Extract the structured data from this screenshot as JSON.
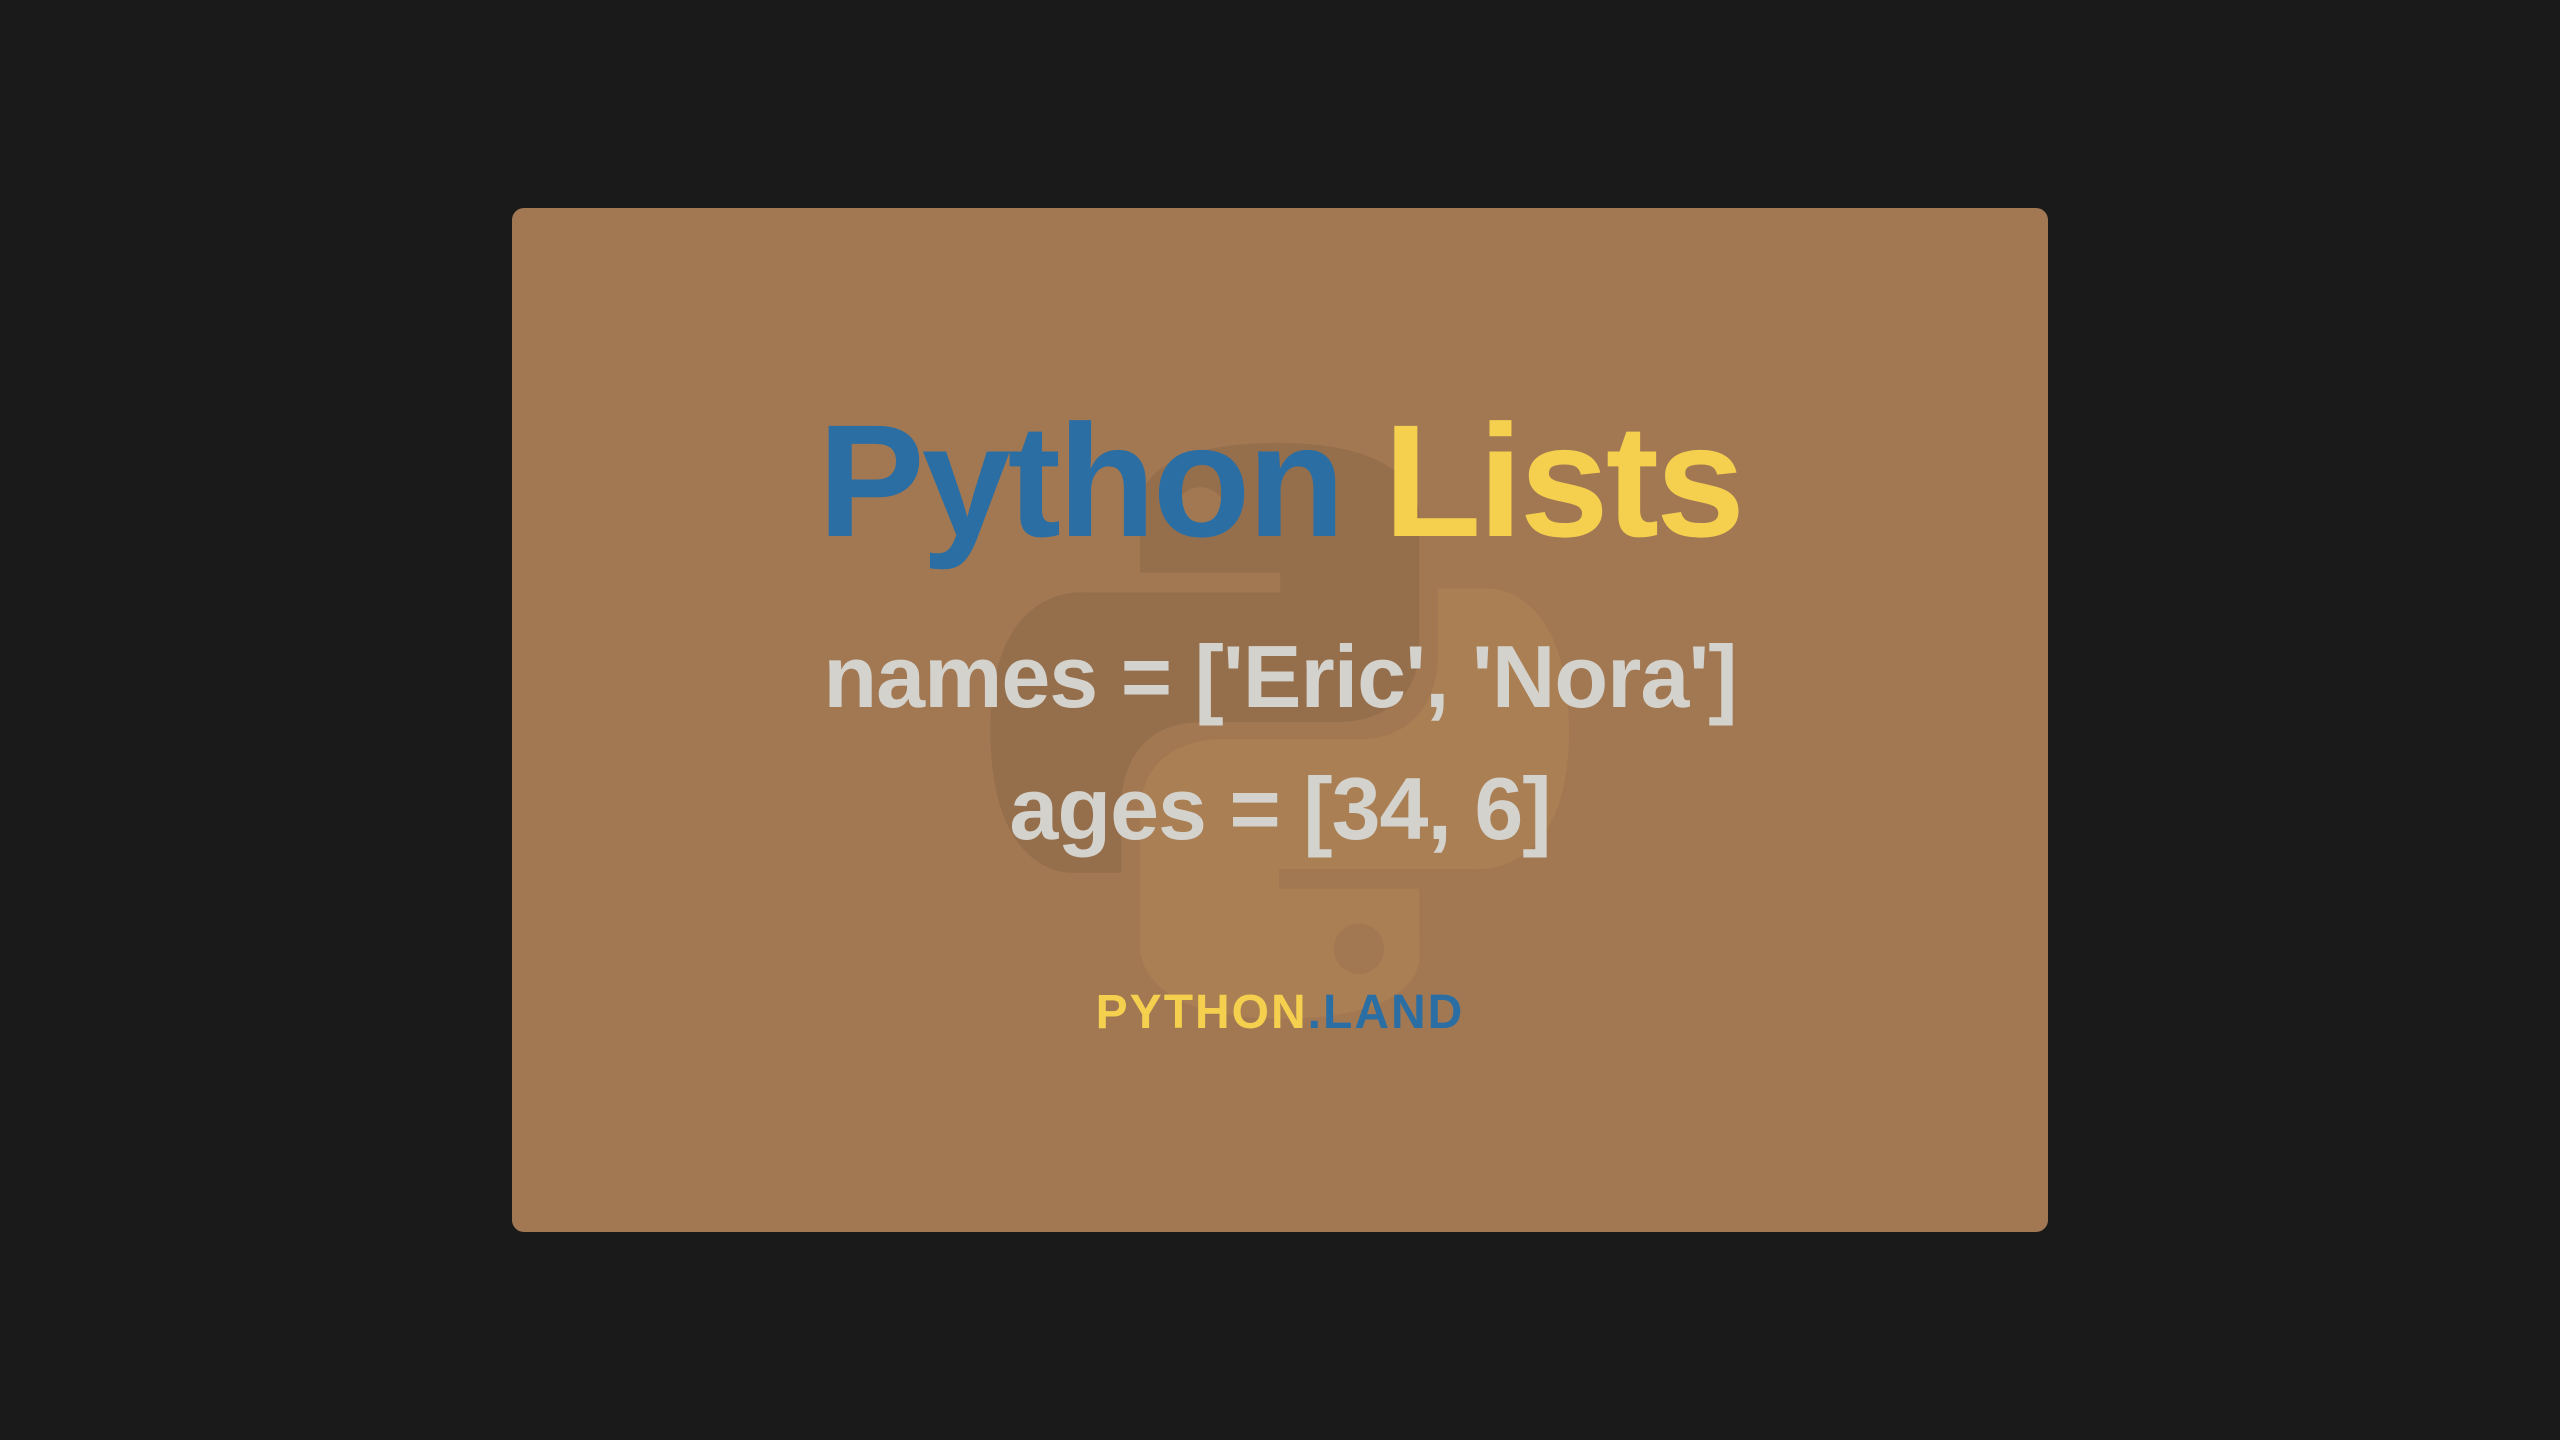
{
  "title": {
    "word1": "Python",
    "word2": "Lists"
  },
  "code": {
    "line1": "names = ['Eric', 'Nora']",
    "line2": "ages = [34, 6]"
  },
  "footer": {
    "word1": "PYTHON",
    "dot": ".",
    "word2": "LAND"
  },
  "colors": {
    "background": "#a27853",
    "blue": "#2b6ea3",
    "yellow": "#f5d04e",
    "lightgray": "#d4d2cd"
  }
}
